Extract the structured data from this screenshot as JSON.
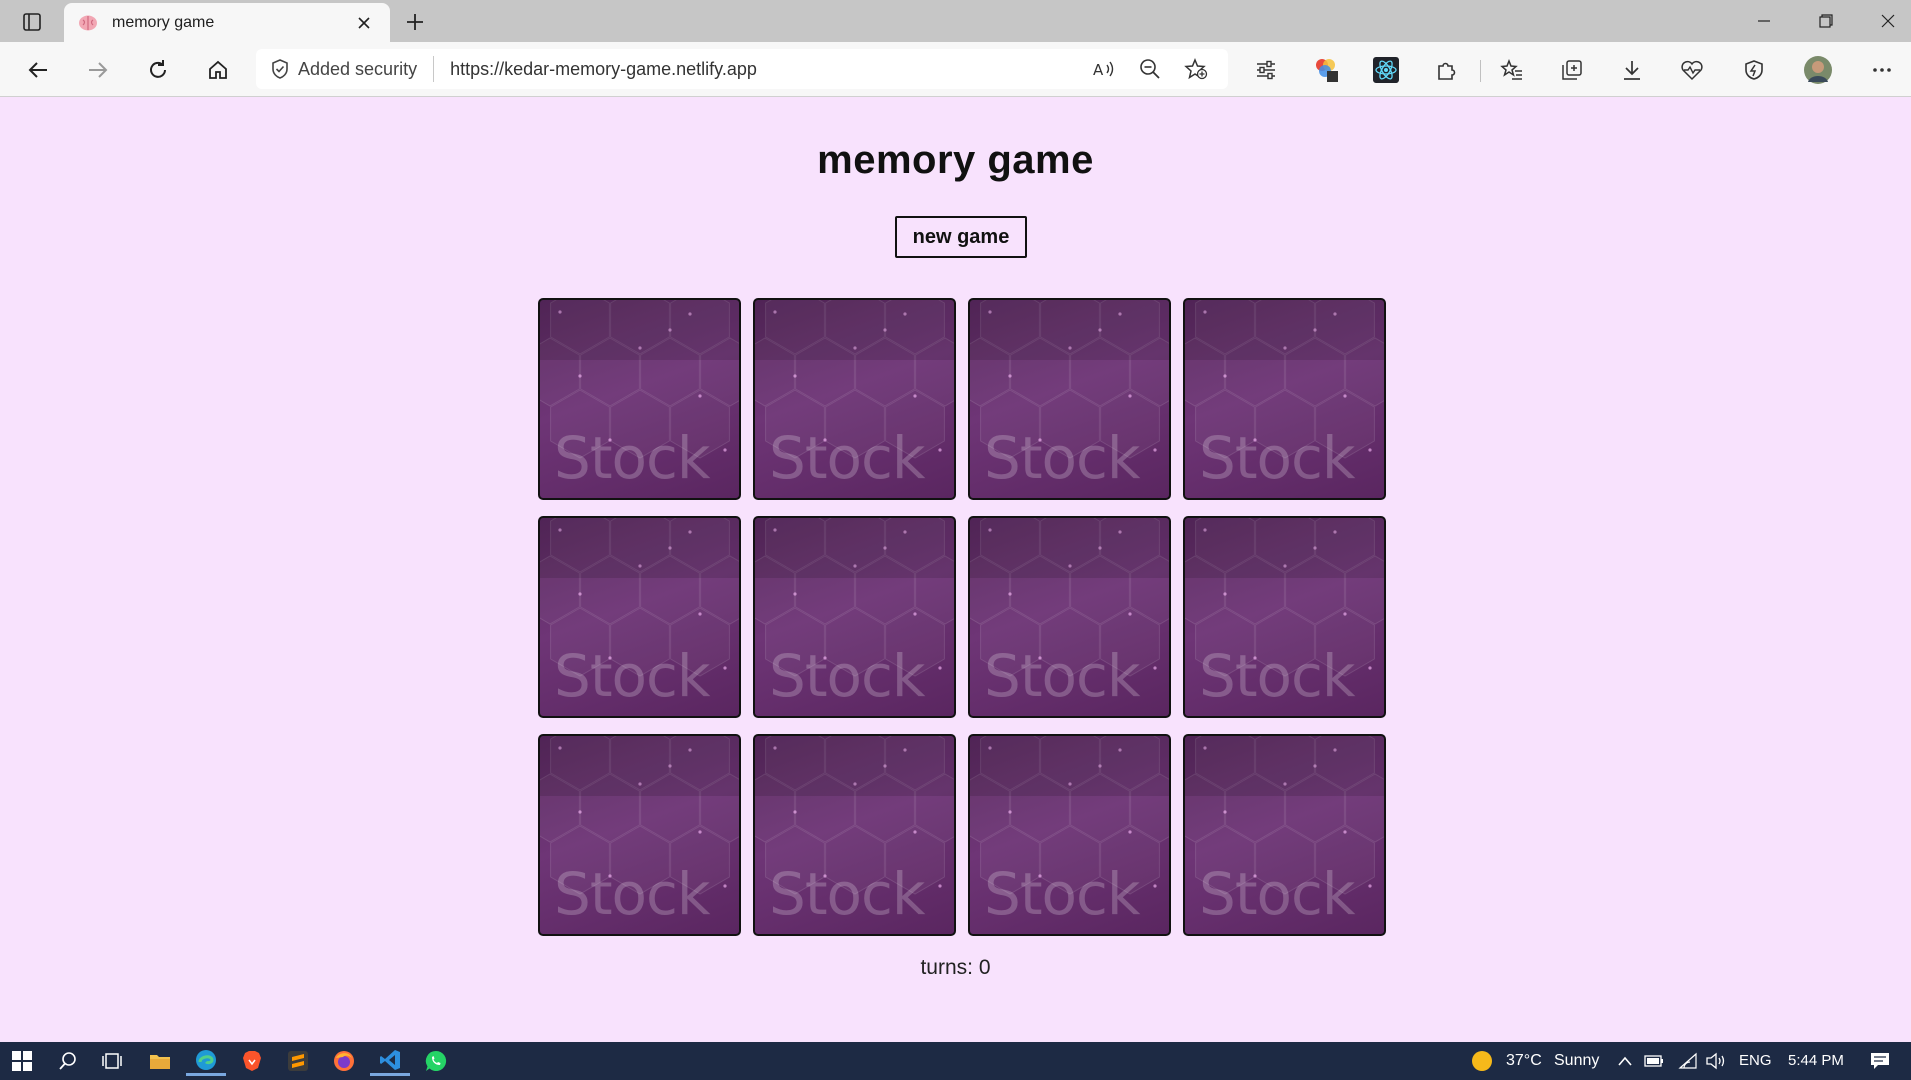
{
  "browser": {
    "tab_title": "memory game",
    "address_security": "Added security",
    "url": "https://kedar-memory-game.netlify.app"
  },
  "page": {
    "title": "memory game",
    "new_game_label": "new game",
    "card_back_text": "Stock",
    "turns_label": "turns: 0"
  },
  "cards": [
    {
      "id": 1
    },
    {
      "id": 2
    },
    {
      "id": 3
    },
    {
      "id": 4
    },
    {
      "id": 5
    },
    {
      "id": 6
    },
    {
      "id": 7
    },
    {
      "id": 8
    },
    {
      "id": 9
    },
    {
      "id": 10
    },
    {
      "id": 11
    },
    {
      "id": 12
    }
  ],
  "taskbar": {
    "weather_temp": "37°C",
    "weather_desc": "Sunny",
    "language": "ENG",
    "time": "5:44 PM"
  },
  "colors": {
    "page_bg": "#f8e2fd",
    "card_bg": "#6e3576",
    "taskbar_bg": "#1d2a44"
  }
}
